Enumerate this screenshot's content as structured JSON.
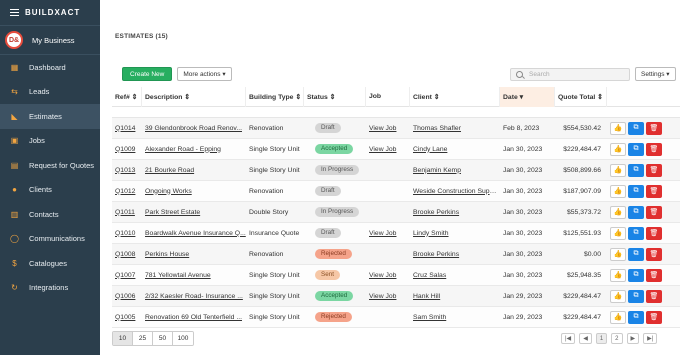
{
  "brand": {
    "prefix": "BUILD",
    "suffix": "XACT"
  },
  "org": {
    "logo_text": "D&",
    "name": "My Business"
  },
  "nav": [
    {
      "label": "Dashboard",
      "icon": "chart-icon"
    },
    {
      "label": "Leads",
      "icon": "leads-icon"
    },
    {
      "label": "Estimates",
      "icon": "estimates-icon",
      "active": true
    },
    {
      "label": "Jobs",
      "icon": "jobs-icon"
    },
    {
      "label": "Request for Quotes",
      "icon": "quote-icon"
    },
    {
      "label": "Clients",
      "icon": "clients-icon"
    },
    {
      "label": "Contacts",
      "icon": "contacts-icon"
    },
    {
      "label": "Communications",
      "icon": "communications-icon"
    },
    {
      "label": "Catalogues",
      "icon": "catalogues-icon"
    },
    {
      "label": "Integrations",
      "icon": "integrations-icon"
    }
  ],
  "page": {
    "title": "ESTIMATES (15)"
  },
  "toolbar": {
    "create_label": "Create New",
    "more_label": "More actions ▾",
    "search_placeholder": "Search",
    "settings_label": "Settings ▾"
  },
  "columns": [
    "Ref# ⇕",
    "Description ⇕",
    "Building Type ⇕",
    "Status ⇕",
    "Job",
    "Client ⇕",
    "Date ▾",
    "Quote Total ⇕"
  ],
  "rows": [
    {
      "ref": "Q1014",
      "desc": "39 Glendonbrook Road Renov...",
      "type": "Renovation",
      "status": "Draft",
      "job": "View Job",
      "client": "Thomas Shafler",
      "date": "Feb 8, 2023",
      "total": "$554,530.42"
    },
    {
      "ref": "Q1009",
      "desc": "Alexander Road - Epping",
      "type": "Single Story Unit",
      "status": "Accepted",
      "job": "View Job",
      "client": "Cindy Lane",
      "date": "Jan 30, 2023",
      "total": "$229,484.47"
    },
    {
      "ref": "Q1013",
      "desc": "21 Bourke Road",
      "type": "Single Story Unit",
      "status": "In Progress",
      "job": "",
      "client": "Benjamin Kemp",
      "date": "Jan 30, 2023",
      "total": "$508,899.66"
    },
    {
      "ref": "Q1012",
      "desc": "Ongoing Works",
      "type": "Renovation",
      "status": "Draft",
      "job": "",
      "client": "Weside Construction Supplie",
      "date": "Jan 30, 2023",
      "total": "$187,907.09"
    },
    {
      "ref": "Q1011",
      "desc": "Park Street Estate",
      "type": "Double Story",
      "status": "In Progress",
      "job": "",
      "client": "Brooke Perkins",
      "date": "Jan 30, 2023",
      "total": "$55,373.72"
    },
    {
      "ref": "Q1010",
      "desc": "Boardwalk Avenue Insurance Q...",
      "type": "Insurance Quote",
      "status": "Draft",
      "job": "View Job",
      "client": "Lindy Smith",
      "date": "Jan 30, 2023",
      "total": "$125,551.93"
    },
    {
      "ref": "Q1008",
      "desc": "Perkins House",
      "type": "Renovation",
      "status": "Rejected",
      "job": "",
      "client": "Brooke Perkins",
      "date": "Jan 30, 2023",
      "total": "$0.00"
    },
    {
      "ref": "Q1007",
      "desc": "781 Yellowtail Avenue",
      "type": "Single Story Unit",
      "status": "Sent",
      "job": "View Job",
      "client": "Cruz Salas",
      "date": "Jan 30, 2023",
      "total": "$25,948.35"
    },
    {
      "ref": "Q1006",
      "desc": "2/32 Kaesler Road- Insurance ...",
      "type": "Single Story Unit",
      "status": "Accepted",
      "job": "View Job",
      "client": "Hank Hill",
      "date": "Jan 29, 2023",
      "total": "$229,484.47"
    },
    {
      "ref": "Q1005",
      "desc": "Renovation 69 Old Tenterfield ...",
      "type": "Single Story Unit",
      "status": "Rejected",
      "job": "",
      "client": "Sam Smith",
      "date": "Jan 29, 2023",
      "total": "$229,484.47"
    }
  ],
  "page_sizes": [
    "10",
    "25",
    "50",
    "100"
  ],
  "pager": {
    "first": "|◀",
    "prev": "◀",
    "pages": [
      "1",
      "2"
    ],
    "next": "▶",
    "last": "▶|"
  },
  "colors": {
    "sidebar": "#2b3e4c",
    "accent": "#f2a541",
    "create": "#27ae60",
    "copy": "#1a84e6",
    "delete": "#e02f2f"
  }
}
